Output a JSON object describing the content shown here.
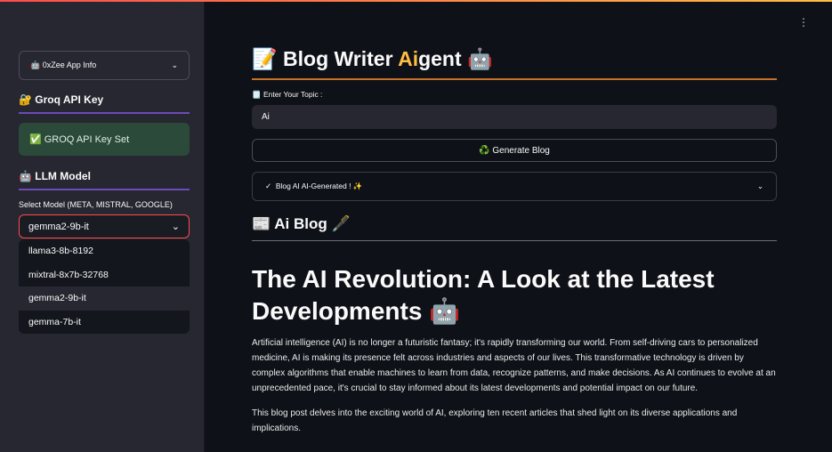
{
  "sidebar": {
    "app_info": "🤖 0xZee App Info",
    "groq_heading": "🔐 Groq API Key",
    "groq_status": "✅ GROQ API Key Set",
    "llm_heading": "🤖 LLM Model",
    "select_label": "Select Model (META, MISTRAL, GOOGLE)",
    "selected_model": "gemma2-9b-it",
    "options": [
      "llama3-8b-8192",
      "mixtral-8x7b-32768",
      "gemma2-9b-it",
      "gemma-7b-it"
    ],
    "highlighted_option": "gemma2-9b-it"
  },
  "main": {
    "title_prefix": "📝 Blog Writer ",
    "title_accent": "Ai",
    "title_suffix": "gent 🤖",
    "accent_color": "#ffbd45",
    "topic_label": "🗒️ Enter Your Topic :",
    "topic_value": "Ai",
    "generate_button": "♻️ Generate Blog",
    "status_expander": "Blog AI AI-Generated ! ✨",
    "blog_heading": "📰 Ai Blog 🖋️",
    "blog_title": "The AI Revolution: A Look at the Latest Developments 🤖",
    "paragraphs": [
      "Artificial intelligence (AI) is no longer a futuristic fantasy; it's rapidly transforming our world. From self-driving cars to personalized medicine, AI is making its presence felt across industries and aspects of our lives. This transformative technology is driven by complex algorithms that enable machines to learn from data, recognize patterns, and make decisions. As AI continues to evolve at an unprecedented pace, it's crucial to stay informed about its latest developments and potential impact on our future.",
      "This blog post delves into the exciting world of AI, exploring ten recent articles that shed light on its diverse applications and implications."
    ]
  }
}
